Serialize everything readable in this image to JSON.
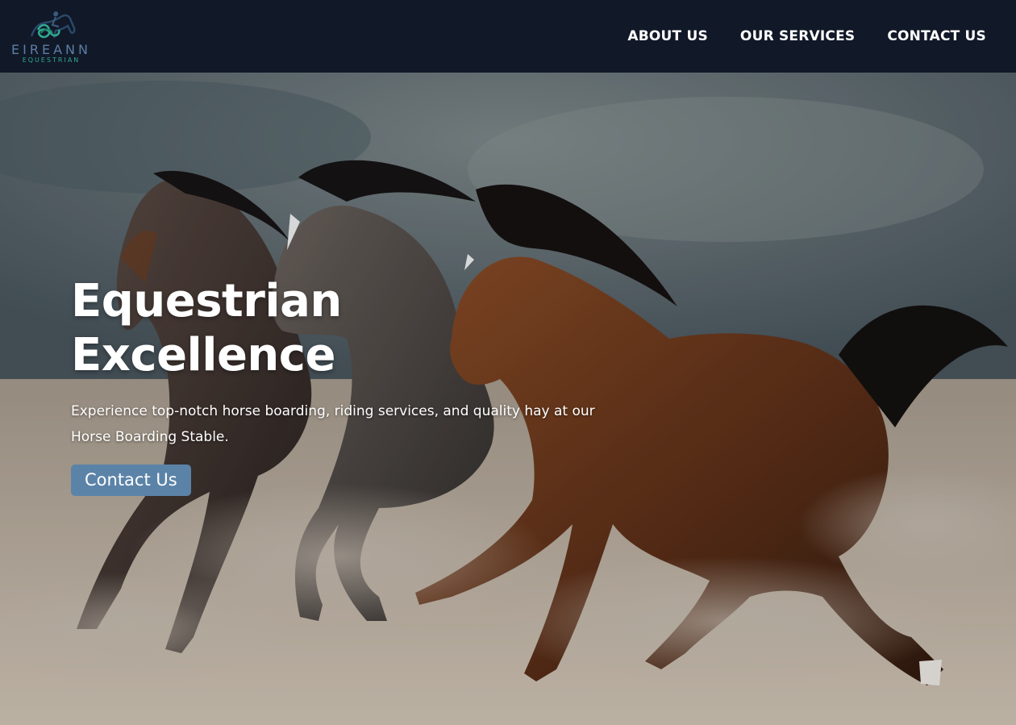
{
  "brand": {
    "name": "EIREANN",
    "tagline": "EQUESTRIAN",
    "logo_icon": "horse-rider-icon",
    "colors": {
      "primary": "#5b7fa6",
      "accent": "#2fa88f"
    }
  },
  "nav": {
    "items": [
      {
        "label": "ABOUT US"
      },
      {
        "label": "OUR SERVICES"
      },
      {
        "label": "CONTACT US"
      }
    ]
  },
  "hero": {
    "title": "Equestrian Excellence",
    "description": "Experience top-notch horse boarding, riding services, and quality hay at our Horse Boarding Stable.",
    "cta_label": "Contact Us",
    "image": "three-galloping-horses-image"
  },
  "colors": {
    "navbar_bg": "#111827",
    "button_bg": "#5b83a8",
    "text": "#ffffff"
  }
}
